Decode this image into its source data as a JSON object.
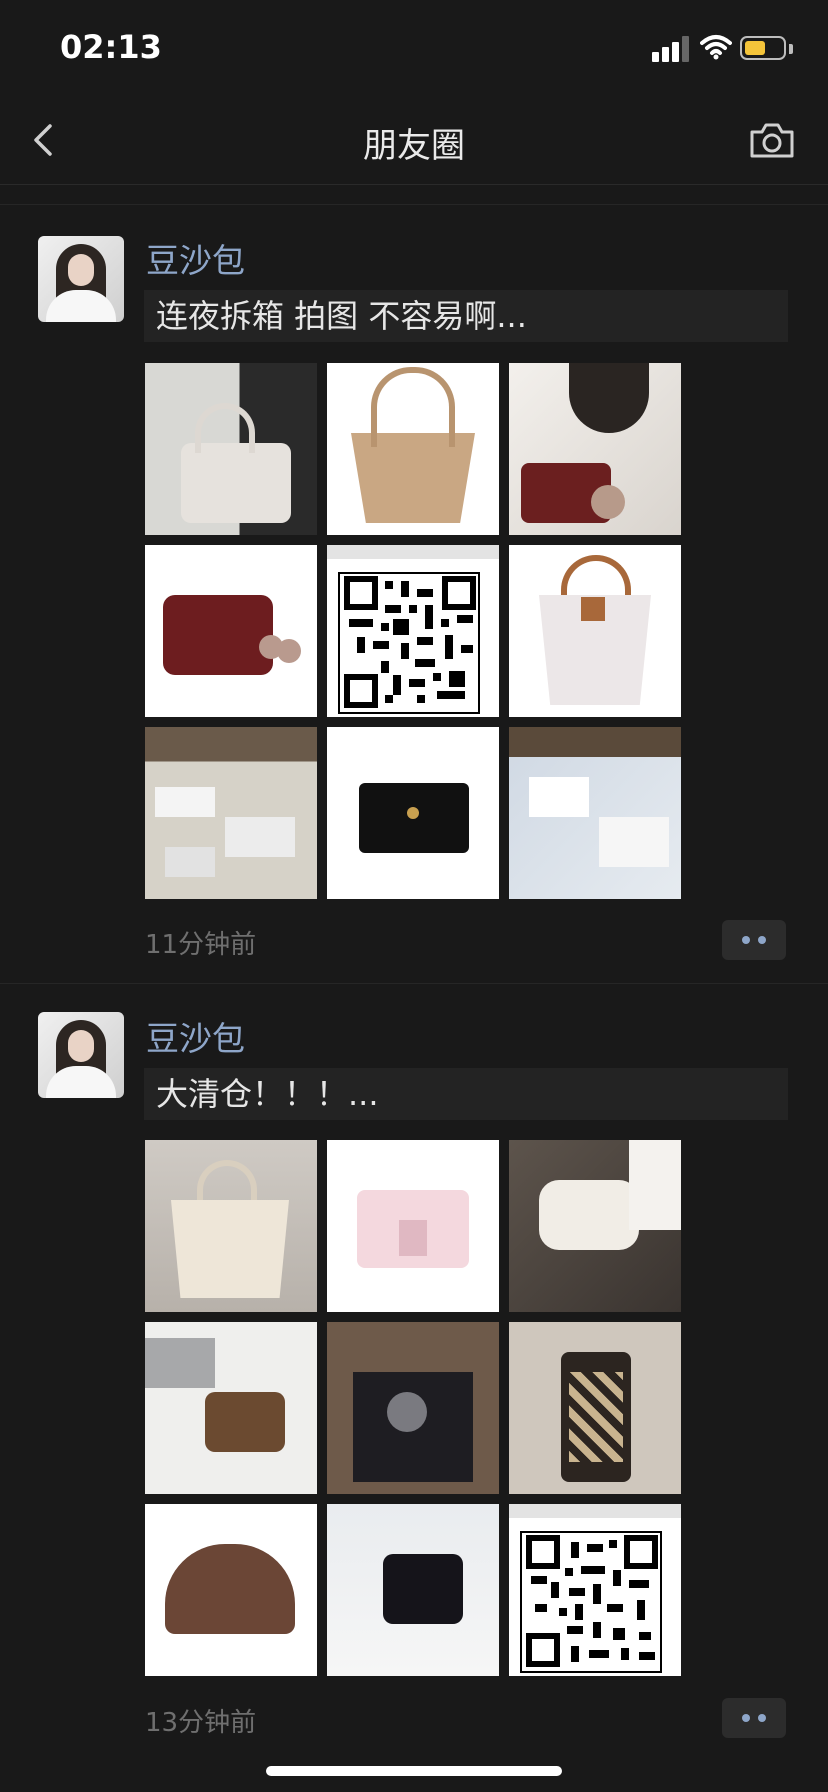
{
  "status_bar": {
    "time": "02:13"
  },
  "nav": {
    "title": "朋友圈"
  },
  "posts": [
    {
      "author": "豆沙包",
      "text": "连夜拆箱 拍图 不容易啊...",
      "time": "11分钟前"
    },
    {
      "author": "豆沙包",
      "text": "大清仓！！！...",
      "time": "13分钟前"
    }
  ],
  "colors": {
    "background": "#191919",
    "author_name": "#8ea6c9",
    "battery": "#f4c43a"
  },
  "icons": [
    "back-icon",
    "camera-icon",
    "wifi-icon",
    "signal-icon",
    "battery-icon",
    "more-icon"
  ]
}
